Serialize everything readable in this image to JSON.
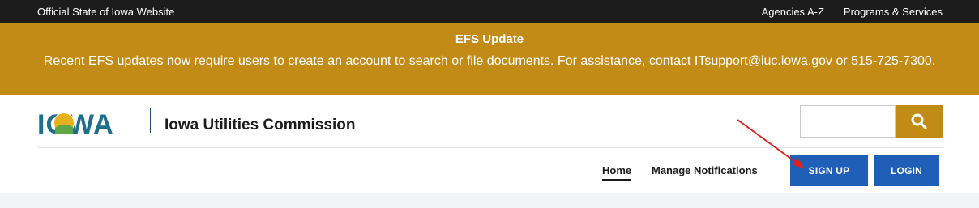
{
  "topbar": {
    "official": "Official State of Iowa Website",
    "agencies": "Agencies A-Z",
    "programs": "Programs & Services"
  },
  "alert": {
    "title": "EFS Update",
    "text_before": "Recent EFS updates now require users to ",
    "link_account": "create an account",
    "text_middle": " to search or file documents. For assistance, contact ",
    "link_email": "ITsupport@iuc.iowa.gov",
    "text_after": " or 515-725-7300."
  },
  "header": {
    "logo_text": "IOWA",
    "site_name": "Iowa Utilities Commission"
  },
  "search": {
    "placeholder": "",
    "icon": "search-icon"
  },
  "nav": {
    "home": "Home",
    "notifications": "Manage Notifications"
  },
  "buttons": {
    "signup": "SIGN UP",
    "login": "LOGIN"
  },
  "colors": {
    "topbar": "#1c1c1c",
    "alert": "#c28b16",
    "primary_button": "#1f5fb8",
    "logo": "#1f6f8b",
    "annotation_arrow": "#e02020"
  }
}
